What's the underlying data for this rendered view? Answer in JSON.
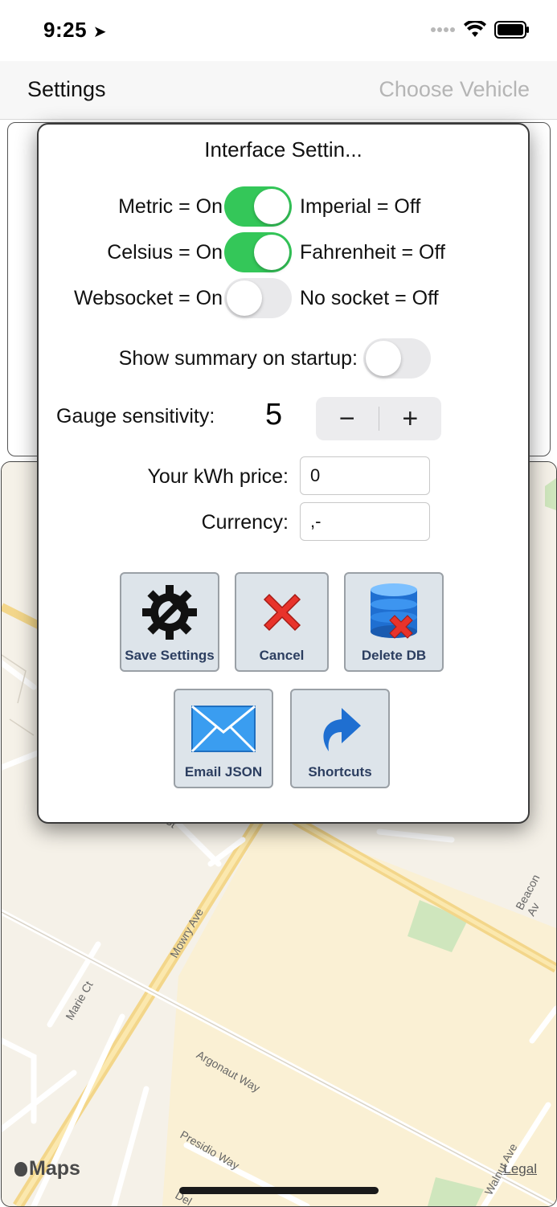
{
  "status_bar": {
    "time": "9:25"
  },
  "nav": {
    "left_title": "Settings",
    "right_title": "Choose Vehicle"
  },
  "dialog": {
    "title": "Interface Settin...",
    "toggles": [
      {
        "left_label": "Metric = On",
        "right_label": "Imperial = Off",
        "state": "on"
      },
      {
        "left_label": "Celsius = On",
        "right_label": "Fahrenheit = Off",
        "state": "on"
      },
      {
        "left_label": "Websocket = On",
        "right_label": "No socket = Off",
        "state": "off"
      }
    ],
    "summary": {
      "label": "Show summary on startup:",
      "state": "off"
    },
    "gauge": {
      "label": "Gauge sensitivity:",
      "value": "5",
      "minus": "−",
      "plus": "+"
    },
    "kwh": {
      "label": "Your kWh price:",
      "value": "0"
    },
    "currency": {
      "label": "Currency:",
      "value": ",-"
    },
    "buttons": {
      "save": "Save Settings",
      "cancel": "Cancel",
      "delete": "Delete DB",
      "email": "Email JSON",
      "shortcuts": "Shortcuts"
    }
  },
  "map": {
    "logo": "Maps",
    "legal": "Legal",
    "street_labels": [
      "St",
      "Mowry Ave",
      "Beacon Av",
      "Marie Ct",
      "Argonaut Way",
      "Presidio Way",
      "Walnut Ave",
      "Del"
    ]
  },
  "colors": {
    "switch_on": "#34c759",
    "switch_off": "#e9e9eb",
    "nav_disabled": "#b5b5b5"
  }
}
